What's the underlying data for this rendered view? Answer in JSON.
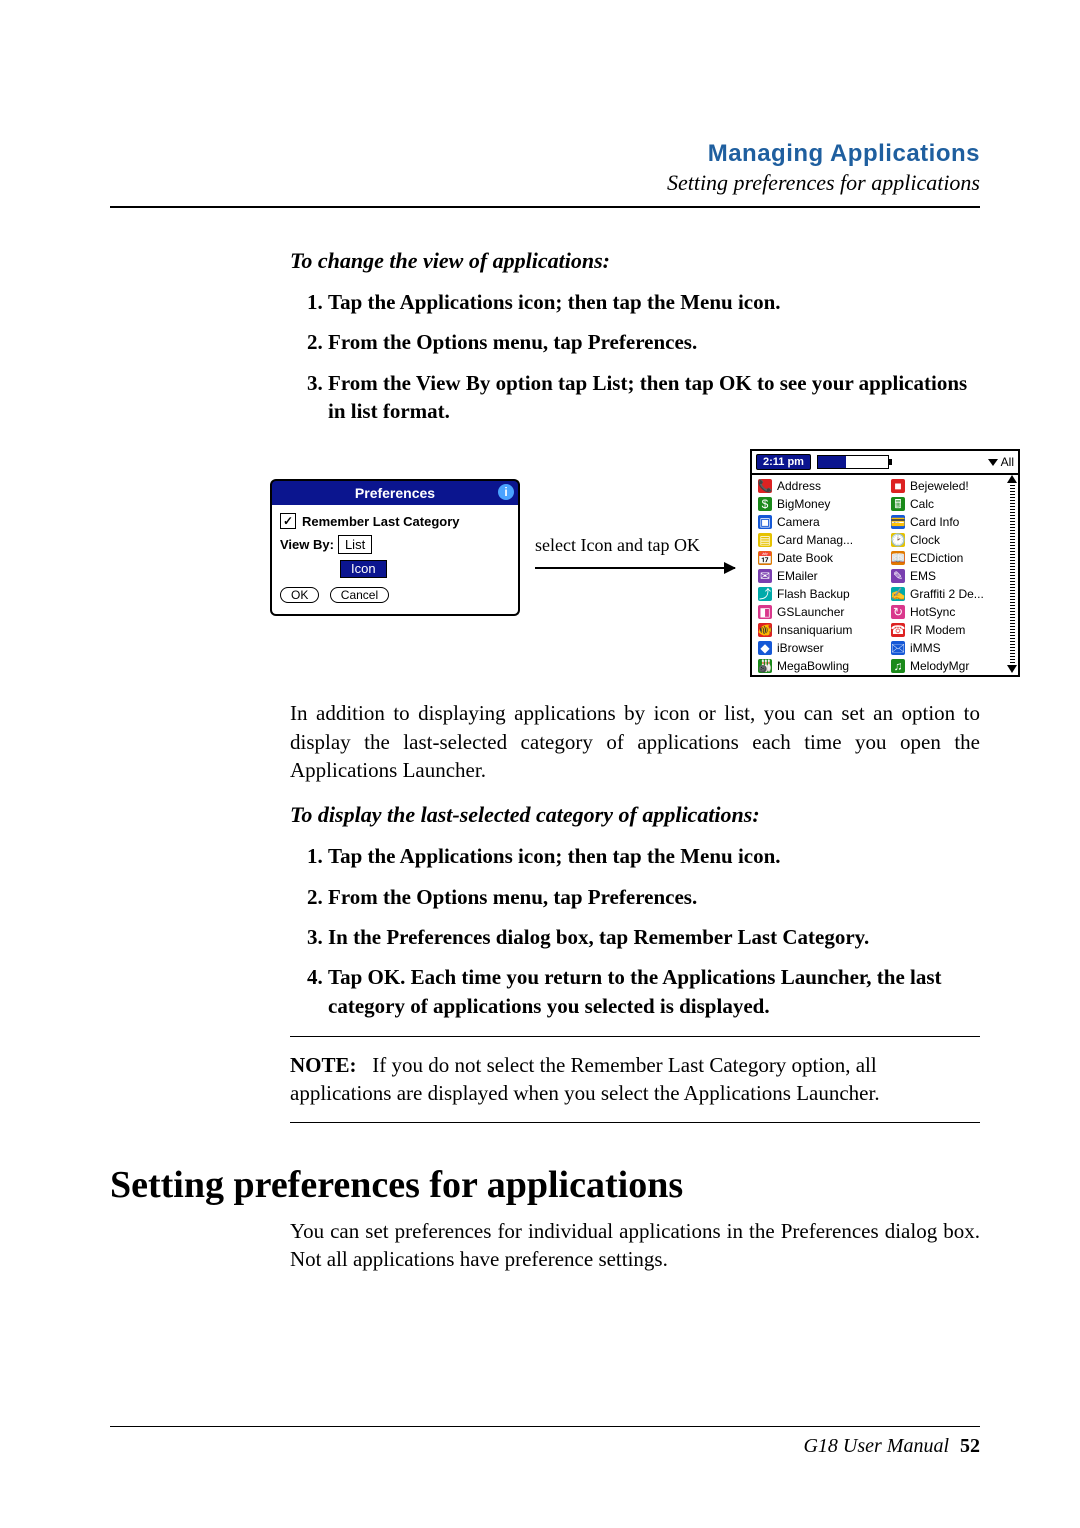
{
  "header": {
    "chapter": "Managing Applications",
    "subtitle": "Setting preferences for applications"
  },
  "procedure1": {
    "title": "To change the view of applications:",
    "steps": [
      "Tap the Applications icon; then tap the Menu icon.",
      "From the Options menu, tap Preferences.",
      "From the View By option tap List; then tap OK to see your applications in list format."
    ]
  },
  "prefs": {
    "title": "Preferences",
    "info_glyph": "i",
    "check_glyph": "✓",
    "remember": "Remember Last Category",
    "viewby_label": "View By:",
    "viewby_value": "List",
    "highlight_value": "Icon",
    "ok": "OK",
    "cancel": "Cancel"
  },
  "figure_caption": "select Icon and tap OK",
  "launcher": {
    "time": "2:11 pm",
    "category": "All",
    "left": [
      {
        "icon_name": "phone-icon",
        "icon_text": "📞",
        "label": "Address"
      },
      {
        "icon_name": "dollar-icon",
        "icon_text": "$",
        "label": "BigMoney"
      },
      {
        "icon_name": "camera-icon",
        "icon_text": "▣",
        "label": "Camera"
      },
      {
        "icon_name": "sdcard-icon",
        "icon_text": "▤",
        "label": "Card Manag..."
      },
      {
        "icon_name": "calendar-icon",
        "icon_text": "📅",
        "label": "Date Book"
      },
      {
        "icon_name": "mail-icon",
        "icon_text": "✉",
        "label": "EMailer"
      },
      {
        "icon_name": "backup-icon",
        "icon_text": "⤴",
        "label": "Flash Backup"
      },
      {
        "icon_name": "launcher-icon",
        "icon_text": "◧",
        "label": "GSLauncher"
      },
      {
        "icon_name": "fish-icon",
        "icon_text": "🐠",
        "label": "Insaniquarium"
      },
      {
        "icon_name": "browser-icon",
        "icon_text": "◆",
        "label": "iBrowser"
      },
      {
        "icon_name": "bowling-icon",
        "icon_text": "🎳",
        "label": "MegaBowling"
      }
    ],
    "right": [
      {
        "icon_name": "gem-icon",
        "icon_text": "■",
        "label": "Bejeweled!"
      },
      {
        "icon_name": "calc-icon",
        "icon_text": "🖩",
        "label": "Calc"
      },
      {
        "icon_name": "card-icon",
        "icon_text": "💳",
        "label": "Card Info"
      },
      {
        "icon_name": "clock-icon",
        "icon_text": "🕑",
        "label": "Clock"
      },
      {
        "icon_name": "dict-icon",
        "icon_text": "📖",
        "label": "ECDiction"
      },
      {
        "icon_name": "ems-icon",
        "icon_text": "✎",
        "label": "EMS"
      },
      {
        "icon_name": "graffiti-icon",
        "icon_text": "✍",
        "label": "Graffiti 2 De..."
      },
      {
        "icon_name": "hotsync-icon",
        "icon_text": "↻",
        "label": "HotSync"
      },
      {
        "icon_name": "modem-icon",
        "icon_text": "☎",
        "label": "IR Modem"
      },
      {
        "icon_name": "imms-icon",
        "icon_text": "🖂",
        "label": "iMMS"
      },
      {
        "icon_name": "melody-icon",
        "icon_text": "♫",
        "label": "MelodyMgr"
      }
    ]
  },
  "body_para1": "In addition to displaying applications by icon or list, you can set an option to display the last-selected category of applications each time you open the Applications Launcher.",
  "procedure2": {
    "title": "To display the last-selected category of applications:",
    "steps": [
      "Tap the Applications icon; then tap the Menu icon.",
      "From the Options menu, tap Preferences.",
      "In the Preferences dialog box, tap Remember Last Category.",
      "Tap OK. Each time you return to the Applications Launcher, the last category of applications you selected is displayed."
    ]
  },
  "note": {
    "label": "NOTE:",
    "text": "If you do not select the Remember Last Category option, all applications are displayed when you select the Applications Launcher."
  },
  "section": {
    "heading": "Setting preferences for applications",
    "para": "You can set preferences for individual applications in the Preferences dialog box. Not all applications have preference settings."
  },
  "footer": {
    "manual": "G18 User Manual",
    "page": "52"
  }
}
